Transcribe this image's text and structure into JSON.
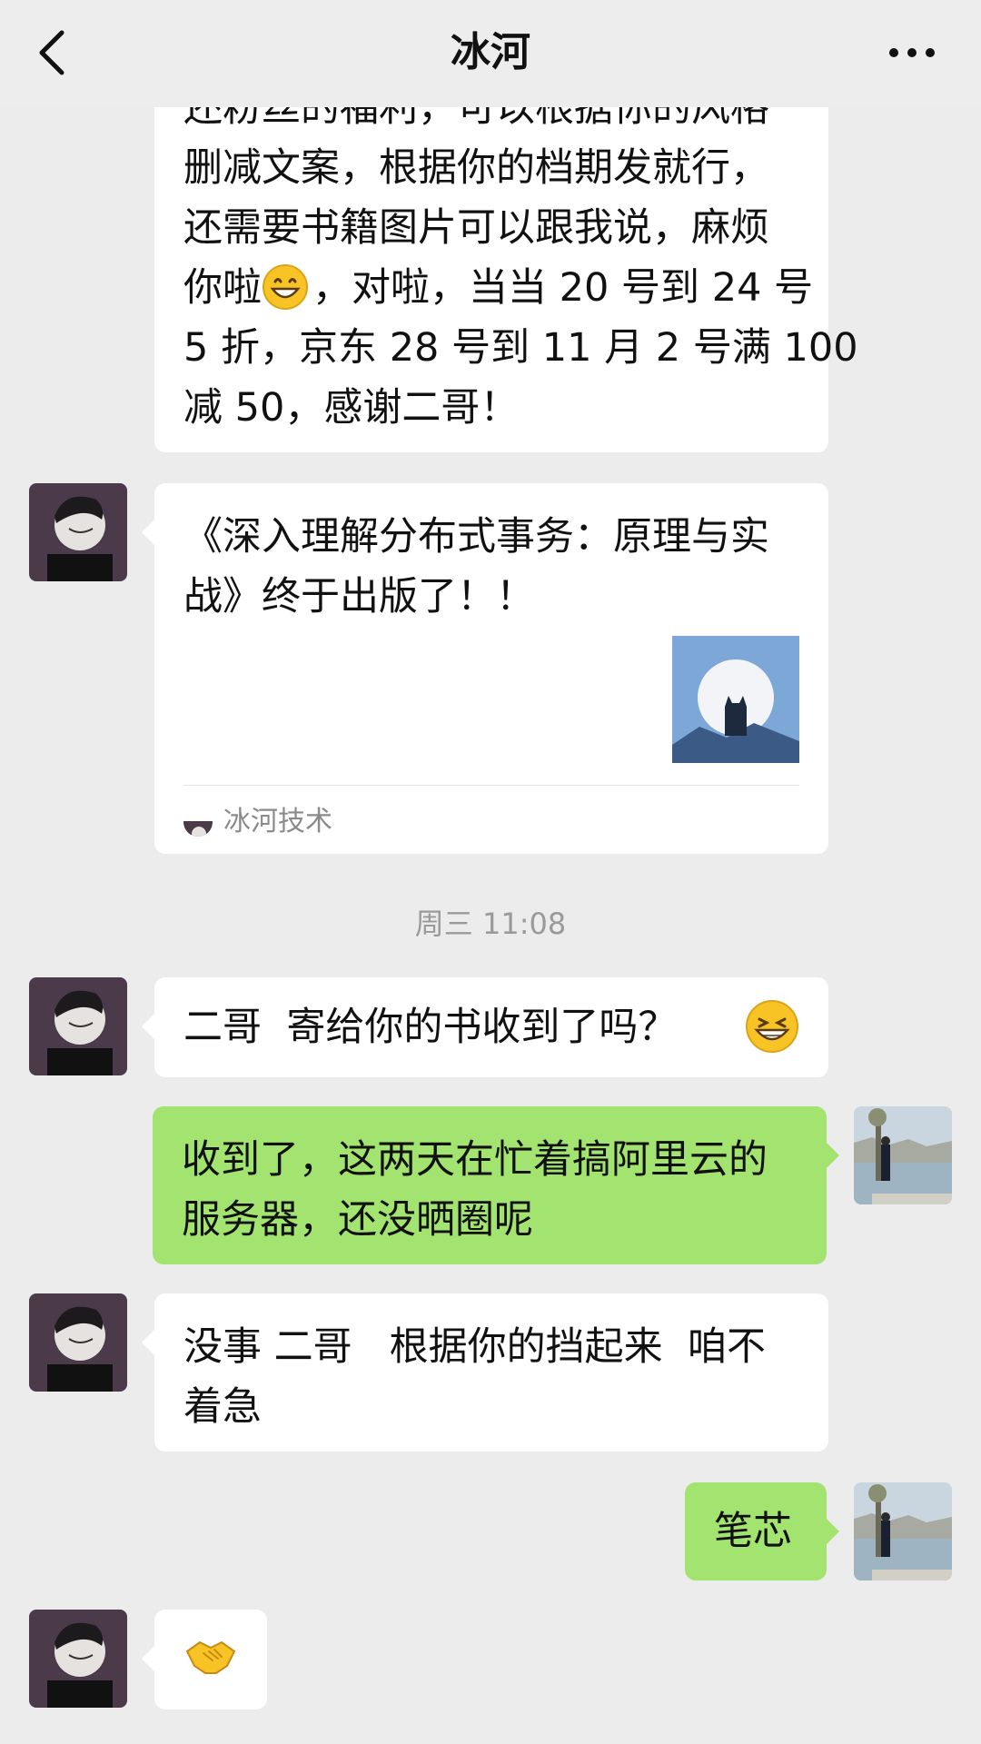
{
  "header": {
    "title": "冰河",
    "back_icon": "chevron-left-icon",
    "more_icon": "more-icon"
  },
  "messages": {
    "m1": {
      "lines": [
        "还粉丝的福利，可以根据你的风格",
        "删减文案，根据你的档期发就行，",
        "还需要书籍图片可以跟我说，麻烦",
        "你啦",
        "，对啦，当当 20 号到 24 号",
        "5 折，京东 28 号到 11 月 2 号满 100",
        "减 50，感谢二哥！"
      ]
    },
    "m2": {
      "title": "《深入理解分布式事务：原理与实战》终于出版了！！",
      "source": "冰河技术"
    },
    "time": "周三 11:08",
    "m3": {
      "text": "二哥  寄给你的书收到了吗？"
    },
    "m4": {
      "text": "收到了，这两天在忙着搞阿里云的服务器，还没晒圈呢"
    },
    "m5": {
      "text": "没事 二哥   根据你的挡起来  咱不着急"
    },
    "m6": {
      "text": "笔芯"
    },
    "m7": {
      "emoji": "handshake-icon"
    }
  },
  "colors": {
    "background": "#ececec",
    "incoming_bubble": "#ffffff",
    "outgoing_bubble": "#a3e36f"
  }
}
